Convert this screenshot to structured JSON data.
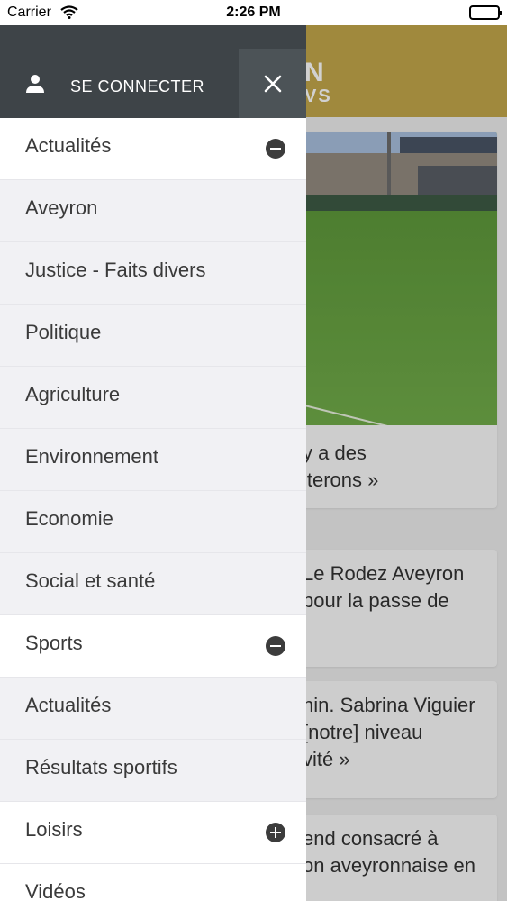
{
  "status_bar": {
    "carrier": "Carrier",
    "time": "2:26 PM",
    "icons": [
      "wifi-icon",
      "battery-icon"
    ]
  },
  "background": {
    "logo_line1": "N",
    "logo_line2": "VS",
    "brand_color": "#c4a84b",
    "articles": [
      {
        "lines": [
          "y a des",
          "iterons »"
        ]
      },
      {
        "lines": [
          "Le Rodez Aveyron",
          "pour la passe de"
        ]
      },
      {
        "lines": [
          "nin. Sabrina Viguier",
          "[notre] niveau",
          "vité »"
        ]
      },
      {
        "lines": [
          "end consacré à",
          "on aveyronnaise en"
        ]
      }
    ]
  },
  "drawer": {
    "login_label": "SE CONNECTER",
    "login_icon": "user-icon",
    "close_icon": "close-icon",
    "header_color": "#3e4448",
    "menu": [
      {
        "label": "Actualités",
        "type": "section",
        "toggle": "collapse"
      },
      {
        "label": "Aveyron",
        "type": "item"
      },
      {
        "label": "Justice - Faits divers",
        "type": "item"
      },
      {
        "label": "Politique",
        "type": "item"
      },
      {
        "label": "Agriculture",
        "type": "item"
      },
      {
        "label": "Environnement",
        "type": "item"
      },
      {
        "label": "Economie",
        "type": "item"
      },
      {
        "label": "Social et santé",
        "type": "item"
      },
      {
        "label": "Sports",
        "type": "section",
        "toggle": "collapse"
      },
      {
        "label": "Actualités",
        "type": "item"
      },
      {
        "label": "Résultats sportifs",
        "type": "item"
      },
      {
        "label": "Loisirs",
        "type": "section",
        "toggle": "expand"
      },
      {
        "label": "Vidéos",
        "type": "item"
      }
    ]
  }
}
